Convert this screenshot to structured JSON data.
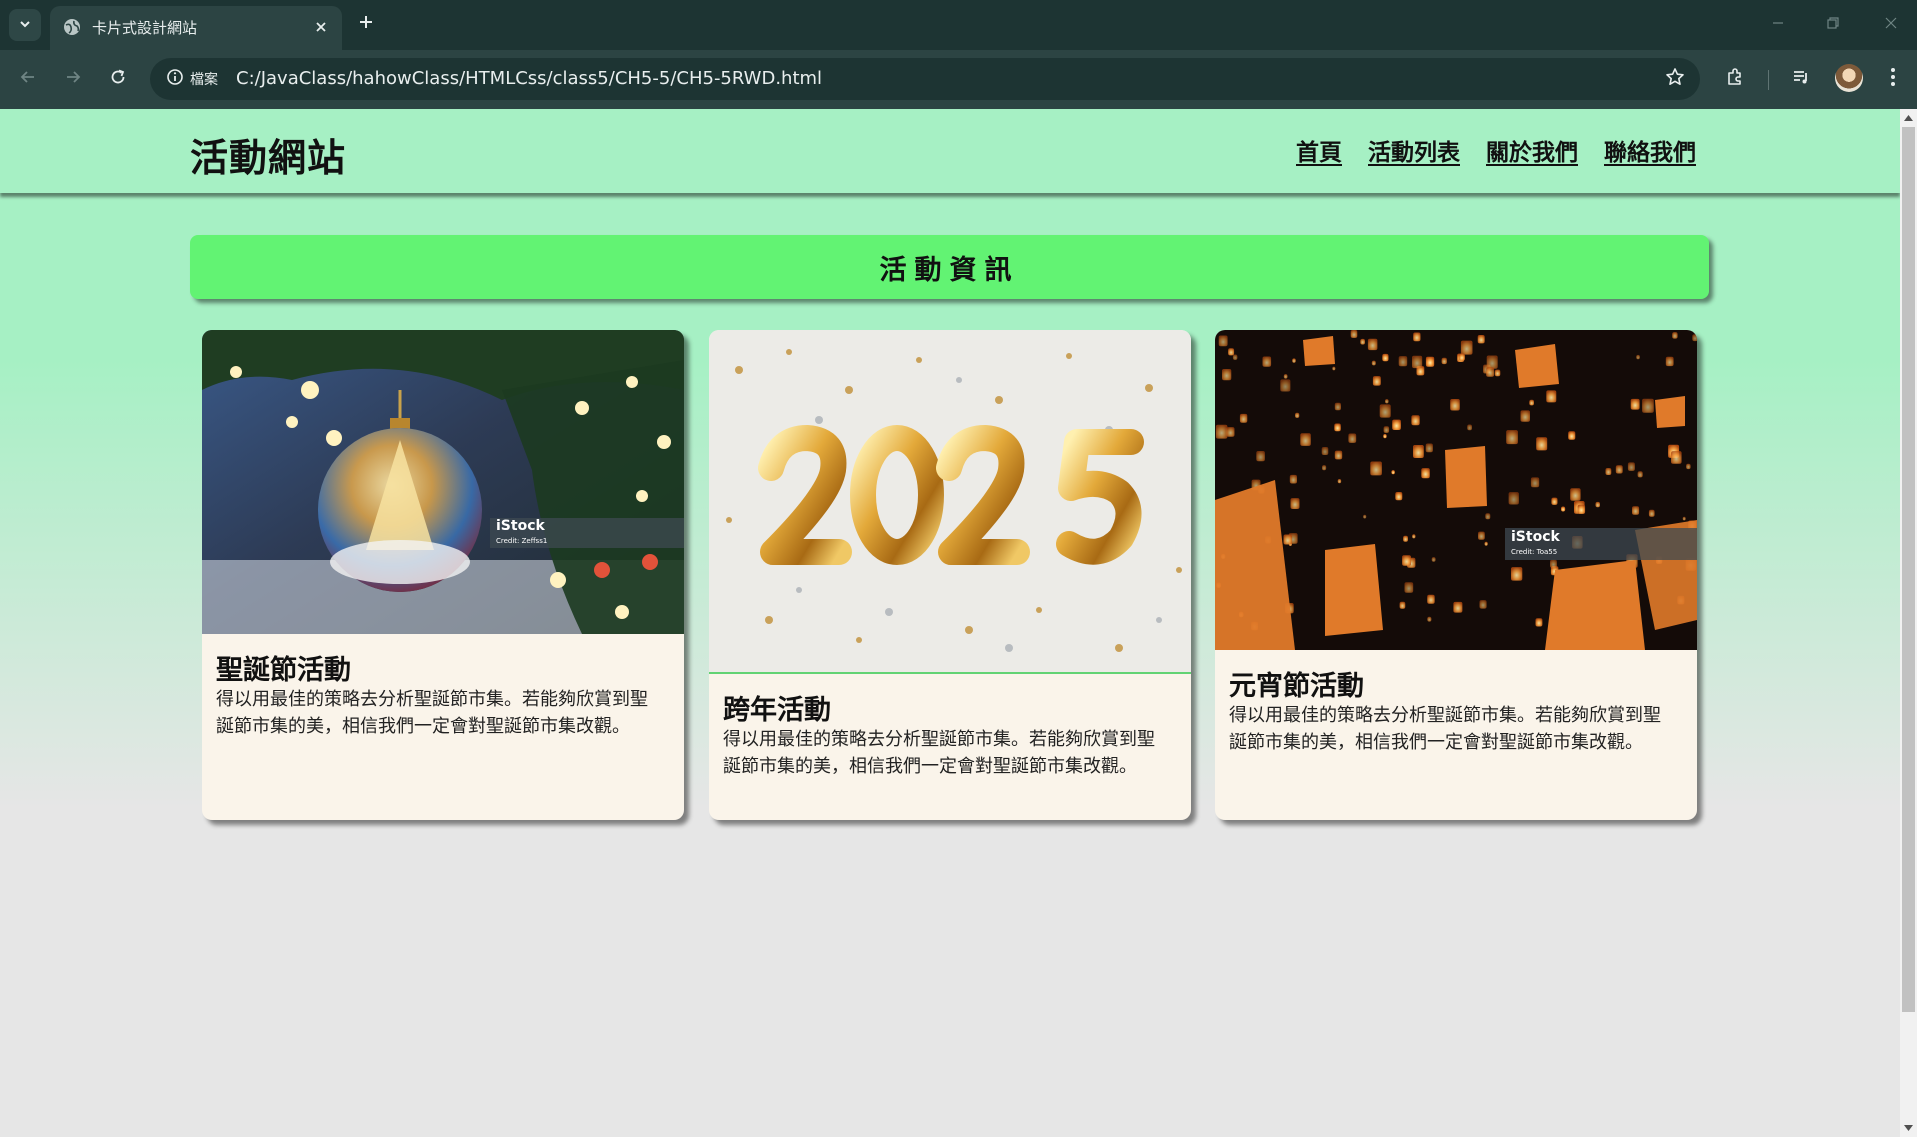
{
  "browser": {
    "tab_title": "卡片式設計網站",
    "site_info_label": "檔案",
    "url": "C:/JavaClass/hahowClass/HTMLCss/class5/CH5-5/CH5-5RWD.html"
  },
  "header": {
    "title": "活動網站",
    "nav": [
      "首頁",
      "活動列表",
      "關於我們",
      "聯絡我們"
    ]
  },
  "banner": {
    "title": "活動資訊"
  },
  "cards": [
    {
      "title": "聖誕節活動",
      "text": "得以用最佳的策略去分析聖誕節市集。若能夠欣賞到聖誕節市集的美，相信我們一定會對聖誕節市集改觀。",
      "image_watermark": "iStock",
      "image_credit": "Credit: Zeffss1"
    },
    {
      "title": "跨年活動",
      "text": "得以用最佳的策略去分析聖誕節市集。若能夠欣賞到聖誕節市集的美，相信我們一定會對聖誕節市集改觀。",
      "image_numbers": "2025"
    },
    {
      "title": "元宵節活動",
      "text": "得以用最佳的策略去分析聖誕節市集。若能夠欣賞到聖誕節市集的美，相信我們一定會對聖誕節市集改觀。",
      "image_watermark": "iStock",
      "image_credit": "Credit: Toa55"
    }
  ],
  "colors": {
    "page_bg": "#a6f0c4",
    "banner_bg": "#62f373",
    "card_bg": "#faf4ea",
    "chrome_dark": "#1d3433",
    "chrome_mid": "#2c4443"
  }
}
